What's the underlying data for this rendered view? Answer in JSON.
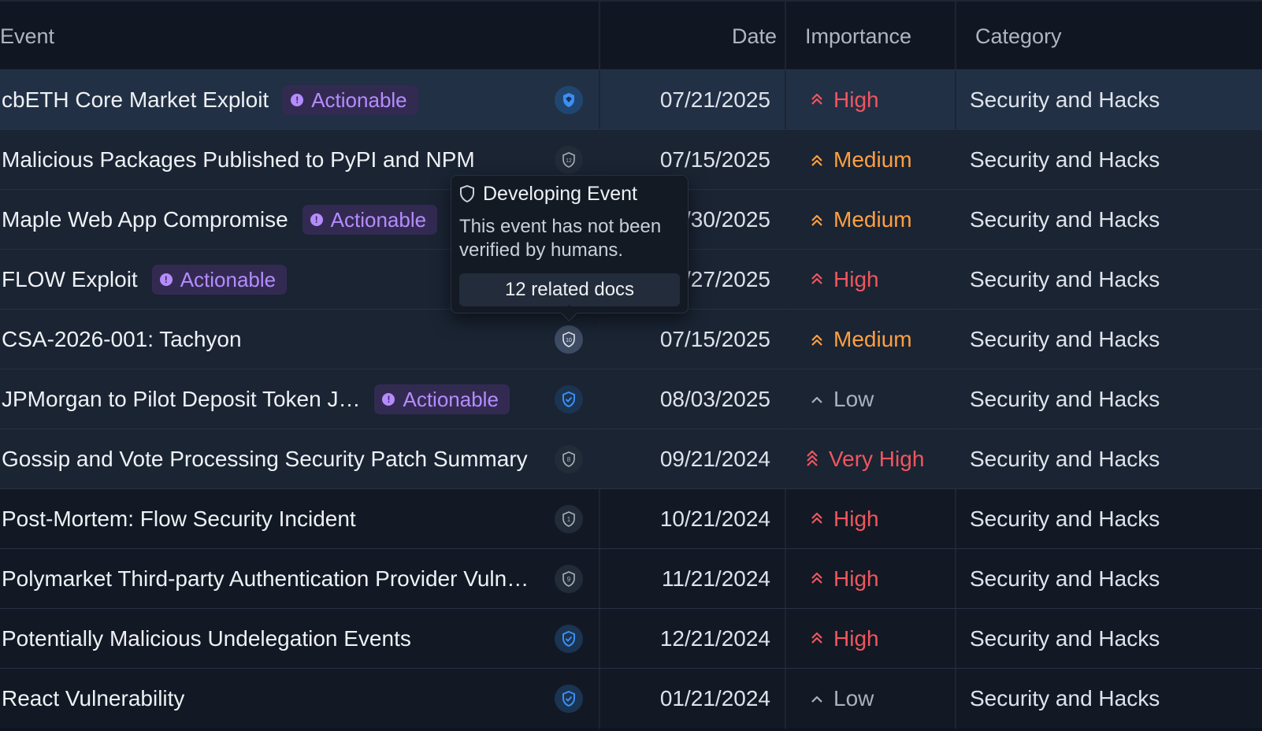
{
  "columns": {
    "event": "Event",
    "date": "Date",
    "importance": "Importance",
    "category": "Category"
  },
  "badge_label": "Actionable",
  "tooltip": {
    "title": "Developing Event",
    "body": "This event has not been verified by humans.",
    "button": "12 related docs"
  },
  "rows": [
    {
      "title": "cbETH Core Market Exploit",
      "actionable": true,
      "shield": "blue-filled",
      "shield_count": "",
      "date": "07/21/2025",
      "importance": "High",
      "category": "Security and Hacks"
    },
    {
      "title": "Malicious Packages Published to PyPI and NPM",
      "actionable": false,
      "shield": "grey",
      "shield_count": "12",
      "date": "07/15/2025",
      "importance": "Medium",
      "category": "Security and Hacks"
    },
    {
      "title": "Maple Web App Compromise",
      "actionable": true,
      "shield": "none",
      "shield_count": "",
      "date": "07/30/2025",
      "importance": "Medium",
      "category": "Security and Hacks"
    },
    {
      "title": "FLOW Exploit",
      "actionable": true,
      "shield": "none",
      "shield_count": "",
      "date": "07/27/2025",
      "importance": "High",
      "category": "Security and Hacks"
    },
    {
      "title": "CSA-2026-001: Tachyon",
      "actionable": false,
      "shield": "grey-light",
      "shield_count": "10",
      "date": "07/15/2025",
      "importance": "Medium",
      "category": "Security and Hacks"
    },
    {
      "title": "JPMorgan to Pilot Deposit Token J…",
      "actionable": true,
      "shield": "blue-check",
      "shield_count": "",
      "date": "08/03/2025",
      "importance": "Low",
      "category": "Security and Hacks"
    },
    {
      "title": "Gossip and Vote Processing Security Patch Summary",
      "actionable": false,
      "shield": "grey",
      "shield_count": "8",
      "date": "09/21/2024",
      "importance": "Very High",
      "category": "Security and Hacks"
    },
    {
      "title": "Post-Mortem: Flow Security Incident",
      "actionable": false,
      "shield": "grey",
      "shield_count": "1",
      "date": "10/21/2024",
      "importance": "High",
      "category": "Security and Hacks"
    },
    {
      "title": "Polymarket Third-party Authentication Provider Vuln…",
      "actionable": false,
      "shield": "grey",
      "shield_count": "9",
      "date": "11/21/2024",
      "importance": "High",
      "category": "Security and Hacks"
    },
    {
      "title": "Potentially Malicious Undelegation Events",
      "actionable": false,
      "shield": "blue-check",
      "shield_count": "",
      "date": "12/21/2024",
      "importance": "High",
      "category": "Security and Hacks"
    },
    {
      "title": "React Vulnerability",
      "actionable": false,
      "shield": "blue-check",
      "shield_count": "",
      "date": "01/21/2024",
      "importance": "Low",
      "category": "Security and Hacks"
    }
  ],
  "colors": {
    "high": "#f0565e",
    "medium": "#ff9f40",
    "low": "#a9b1bd",
    "actionable": "#b58cff",
    "accent_blue": "#3d8ef0"
  }
}
